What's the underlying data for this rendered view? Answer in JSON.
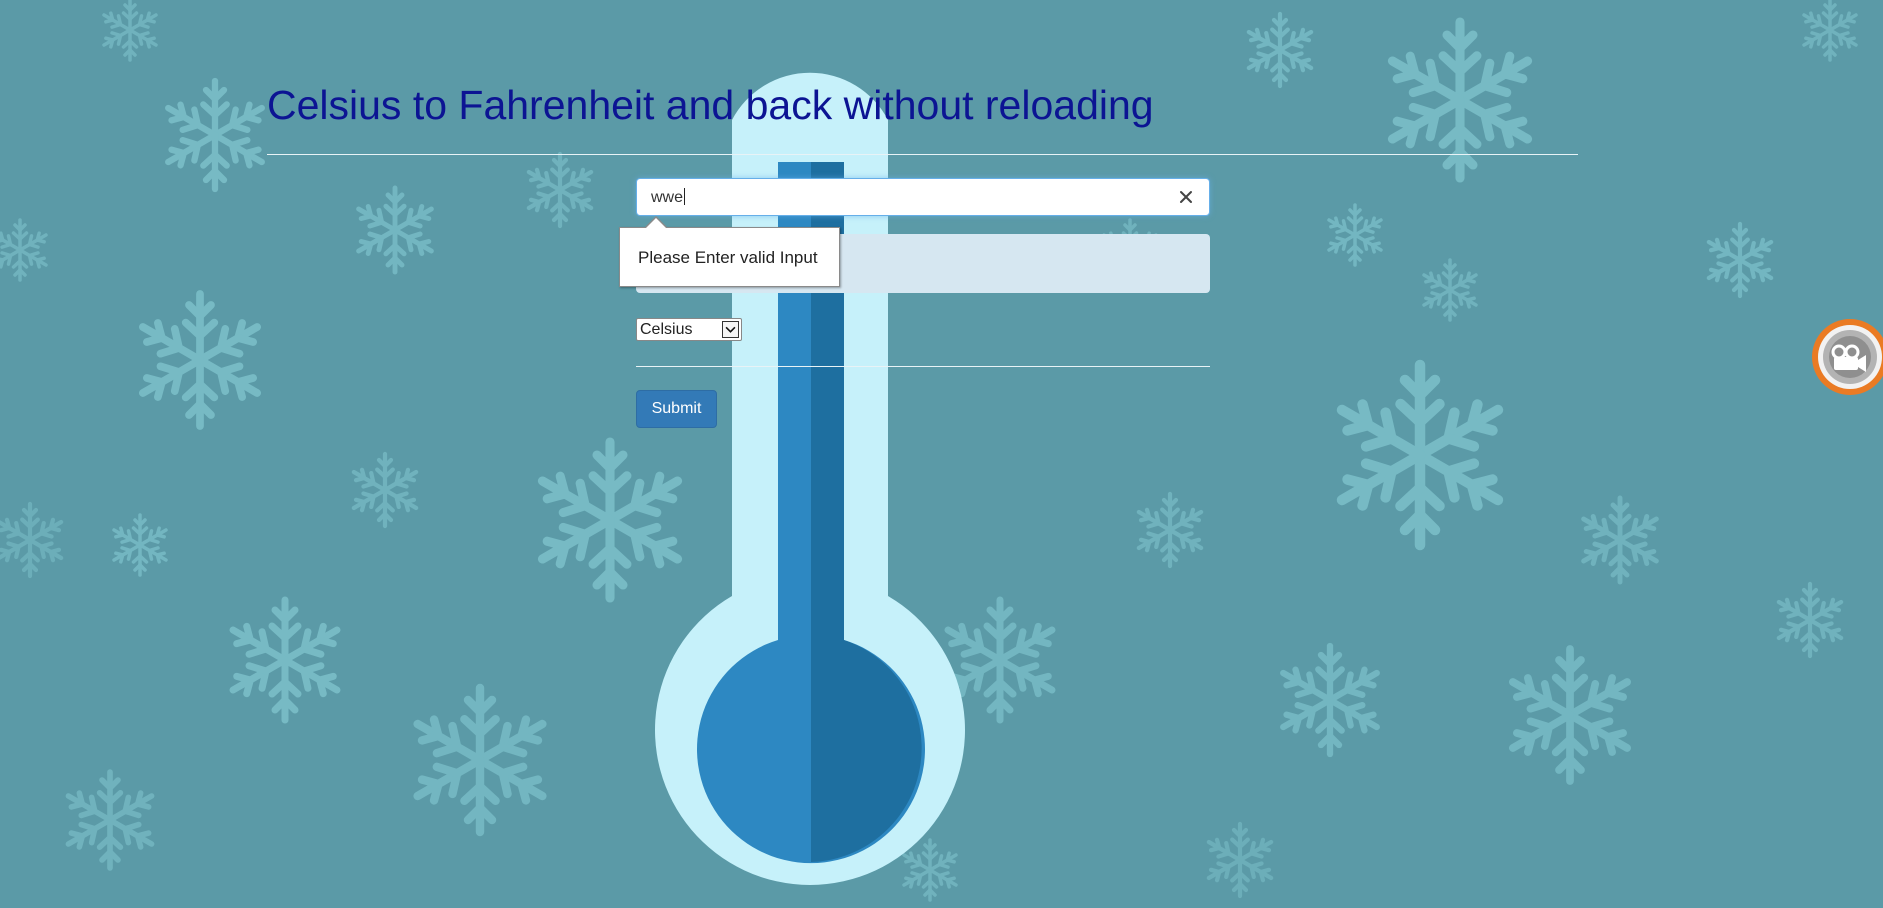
{
  "page": {
    "title": "Celsius to Fahrenheit and back without reloading"
  },
  "form": {
    "temperature_input": {
      "value": "wwe"
    },
    "validation": {
      "message": "Please Enter valid Input"
    },
    "unit_select": {
      "selected": "Celsius"
    },
    "submit_label": "Submit"
  },
  "colors": {
    "background": "#5b9aa7",
    "title": "#0c1493",
    "submit": "#337ab7",
    "result_box": "#d6e7f1",
    "thermometer_outer": "#c6f1fa",
    "thermometer_inner": "#2d88c2",
    "record_widget": "#ea7b24"
  },
  "icons": {
    "clear": "close-icon",
    "dropdown": "chevron-down-icon",
    "record": "video-camera-icon",
    "snowflake": "snowflake-icon",
    "thermometer": "thermometer-icon"
  }
}
